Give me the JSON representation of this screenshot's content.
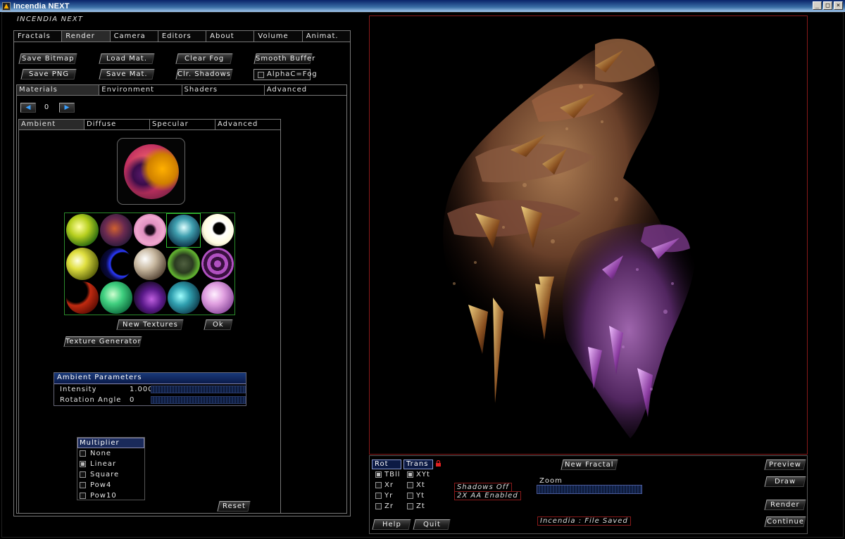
{
  "window": {
    "title": "Incendia NEXT",
    "controls": [
      "_",
      "□",
      "×"
    ]
  },
  "app": {
    "brand": "INCENDIA NEXT"
  },
  "main_tabs": [
    "Fractals",
    "Render",
    "Camera",
    "Editors",
    "About",
    "Volume",
    "Animat."
  ],
  "main_tab_active": "Render",
  "toolbar": {
    "save_bitmap": "Save Bitmap",
    "load_mat": "Load Mat.",
    "clear_fog": "Clear Fog",
    "smooth_buffer": "Smooth Buffer",
    "save_png": "Save PNG",
    "save_mat": "Save Mat.",
    "clr_shadows": "Clr. Shadows",
    "alpha_fog": {
      "label": "AlphaC=Fog",
      "checked": false
    }
  },
  "sub_tabs": [
    "Materials",
    "Environment",
    "Shaders",
    "Advanced"
  ],
  "material": {
    "index": "0",
    "prev_icon": "triangle-left-icon",
    "next_icon": "triangle-right-icon"
  },
  "material_tabs": [
    "Ambient",
    "Diffuse",
    "Specular",
    "Advanced"
  ],
  "texture_gallery": {
    "count": 15,
    "selected_index": 3
  },
  "buttons": {
    "new_textures": "New Textures",
    "ok": "Ok",
    "texture_generator": "Texture Generator",
    "reset": "Reset"
  },
  "ambient_params": {
    "title": "Ambient Parameters",
    "rows": [
      {
        "name": "Intensity",
        "value": "1.000"
      },
      {
        "name": "Rotation Angle",
        "value": "0"
      }
    ]
  },
  "multiplier": {
    "title": "Multiplier",
    "options": [
      {
        "label": "None",
        "checked": false
      },
      {
        "label": "Linear",
        "checked": true
      },
      {
        "label": "Square",
        "checked": false
      },
      {
        "label": "Pow4",
        "checked": false
      },
      {
        "label": "Pow10",
        "checked": false
      }
    ]
  },
  "controls": {
    "rot": {
      "title": "Rot",
      "rows": [
        {
          "label": "TBll",
          "checked": true
        },
        {
          "label": "Xr",
          "checked": false
        },
        {
          "label": "Yr",
          "checked": false
        },
        {
          "label": "Zr",
          "checked": false
        }
      ]
    },
    "trans": {
      "title": "Trans",
      "rows": [
        {
          "label": "XYt",
          "checked": true
        },
        {
          "label": "Xt",
          "checked": false
        },
        {
          "label": "Yt",
          "checked": false
        },
        {
          "label": "Zt",
          "checked": false
        }
      ]
    },
    "lock_icon": "lock-icon",
    "new_fractal": "New Fractal",
    "status_shadows": "Shadows Off",
    "status_aa": "2X AA Enabled",
    "zoom_label": "Zoom",
    "status_message": "Incendia :  File Saved",
    "help": "Help",
    "quit": "Quit",
    "preview": "Preview",
    "draw": "Draw",
    "render": "Render",
    "continue": "Continue"
  },
  "colors": {
    "accent_red": "#8a1a1a",
    "panel_blue": "#1a2a5a",
    "gallery_green": "#2a8a2a"
  }
}
